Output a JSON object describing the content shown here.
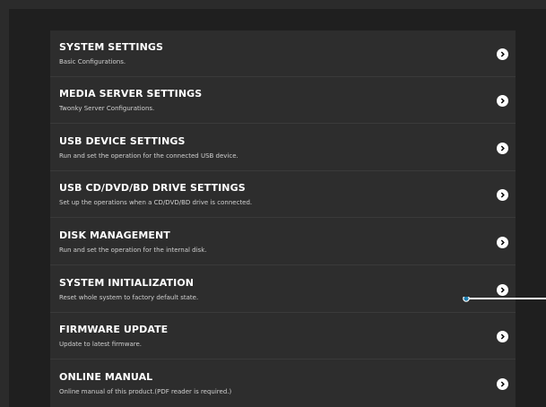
{
  "menu": {
    "items": [
      {
        "title": "SYSTEM SETTINGS",
        "description": "Basic Configurations."
      },
      {
        "title": "MEDIA SERVER SETTINGS",
        "description": "Twonky Server Configurations."
      },
      {
        "title": "USB DEVICE SETTINGS",
        "description": "Run and set the operation for the connected USB device."
      },
      {
        "title": "USB CD/DVD/BD DRIVE SETTINGS",
        "description": "Set up the operations when a CD/DVD/BD drive is connected."
      },
      {
        "title": "DISK MANAGEMENT",
        "description": "Run and set the operation for the internal disk."
      },
      {
        "title": "SYSTEM INITIALIZATION",
        "description": "Reset whole system to factory default state."
      },
      {
        "title": "FIRMWARE UPDATE",
        "description": "Update to latest firmware."
      },
      {
        "title": "ONLINE MANUAL",
        "description": "Online manual of this product.(PDF reader is required.)"
      }
    ]
  },
  "icons": {
    "chevron": "chevron-right-icon",
    "callout": "callout-pointer"
  },
  "colors": {
    "background": "#2b2b2b",
    "panel": "#2d2d2d",
    "text_primary": "#ffffff",
    "text_secondary": "#d0d0d0",
    "callout": "#1f7fb0"
  }
}
